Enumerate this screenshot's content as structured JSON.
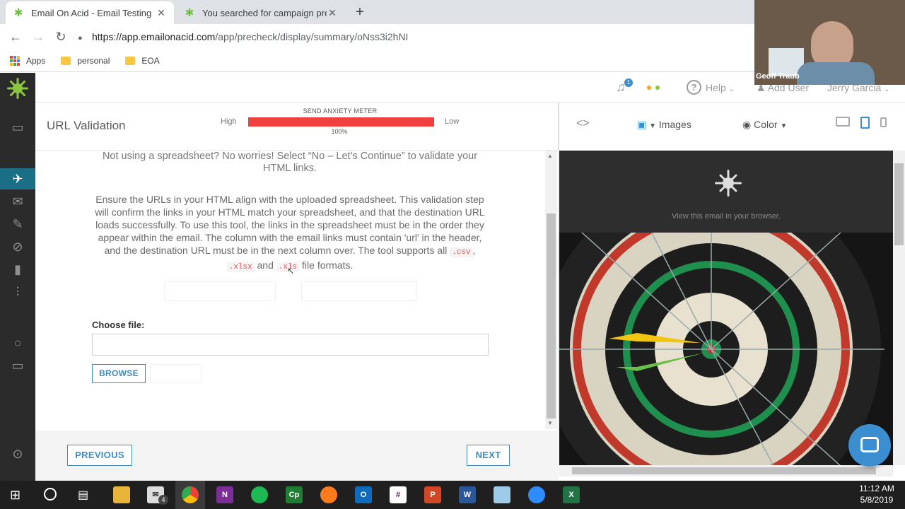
{
  "browser": {
    "tabs": [
      {
        "title": "Email On Acid - Email Testing",
        "active": true
      },
      {
        "title": "You searched for campaign prec",
        "active": false
      }
    ],
    "url_host": "https://app.emailonacid.com",
    "url_path": "/app/precheck/display/summary/oNss3i2hNI",
    "bookmarks": [
      "Apps",
      "personal",
      "EOA"
    ]
  },
  "video": {
    "name": "Geoff Traub"
  },
  "appbar": {
    "notification_count": "1",
    "help": "Help",
    "add_user": "Add User",
    "user": "Jerry Garcia"
  },
  "page": {
    "title": "URL Validation",
    "meter": {
      "label": "SEND ANXIETY METER",
      "high": "High",
      "low": "Low",
      "percent": "100%",
      "value": 1.0
    },
    "intro_line1": "Not using a spreadsheet? No worries! Select “No – Let’s Continue” to validate your",
    "intro_line2": "HTML links.",
    "desc_lines": [
      "Ensure the URLs in your HTML align with the uploaded spreadsheet. This validation step",
      "will confirm the links in your HTML match your spreadsheet, and that the destination URL",
      "loads successfully. To use this tool, the links in the spreadsheet must be in the order they",
      "appear within the email. The column with the email links must contain 'url' in the header,",
      "and the destination URL must be in the next column over. The tool supports all"
    ],
    "ext_csv": ".csv",
    "ext_xlsx": ".xlsx",
    "and": "and",
    "ext_xls": ".xls",
    "formats_tail": "file formats.",
    "choose_file": "Choose file:",
    "browse": "BROWSE",
    "previous": "PREVIOUS",
    "next": "NEXT"
  },
  "preview": {
    "images": "Images",
    "color": "Color",
    "view_in_browser": "View this email in your browser."
  },
  "taskbar": {
    "time": "11:12 AM",
    "date": "5/8/2019",
    "mail_badge": "4"
  }
}
